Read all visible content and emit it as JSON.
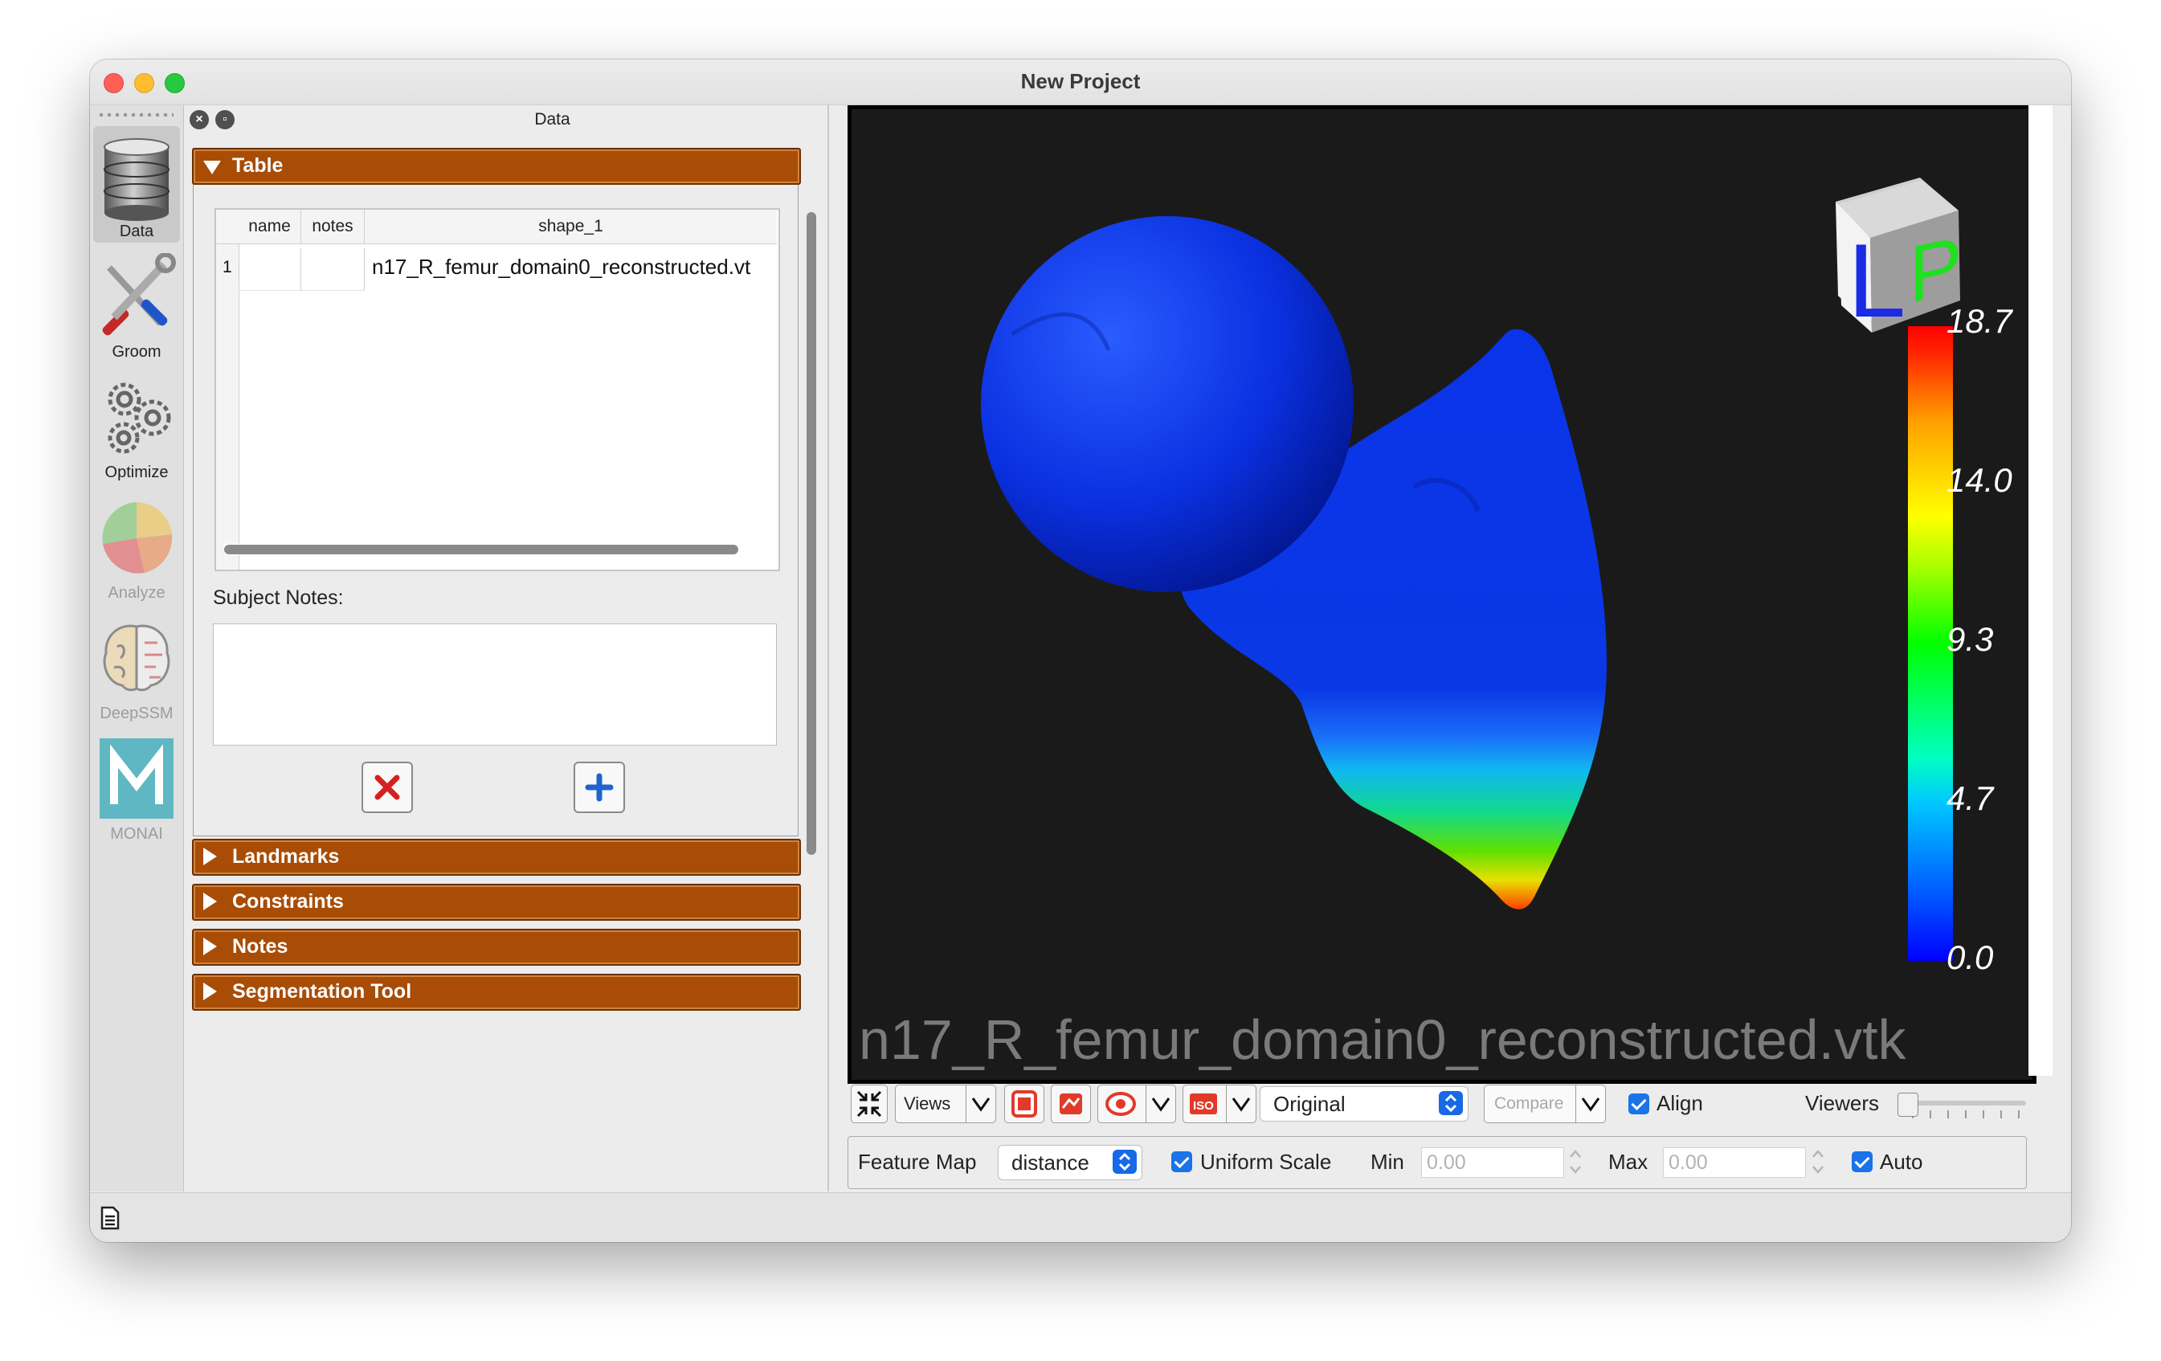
{
  "window": {
    "title": "New Project"
  },
  "modules": [
    {
      "label": "Data",
      "icon": "database-icon",
      "active": true
    },
    {
      "label": "Groom",
      "icon": "tools-icon"
    },
    {
      "label": "Optimize",
      "icon": "gears-icon"
    },
    {
      "label": "Analyze",
      "icon": "pie-chart-icon",
      "disabled": true
    },
    {
      "label": "DeepSSM",
      "icon": "brain-icon",
      "disabled": true
    },
    {
      "label": "MONAI",
      "icon": "monai-icon",
      "disabled": true
    }
  ],
  "panel": {
    "title": "Data",
    "sections": {
      "table": "Table",
      "landmarks": "Landmarks",
      "constraints": "Constraints",
      "notes": "Notes",
      "segmentation": "Segmentation Tool"
    },
    "table": {
      "columns": [
        "name",
        "notes",
        "shape_1"
      ],
      "rows": [
        {
          "index": "1",
          "name": "",
          "notes": "",
          "shape_1": "n17_R_femur_domain0_reconstructed.vt"
        }
      ]
    },
    "subject_notes_label": "Subject Notes:"
  },
  "viewer": {
    "filename": "n17_R_femur_domain0_reconstructed.vtk",
    "orientation": {
      "face_left": "L",
      "face_right": "P"
    },
    "colorbar": {
      "ticks": [
        "18.7",
        "14.0",
        "9.3",
        "4.7",
        "0.0"
      ],
      "min": 0.0,
      "max": 18.7
    }
  },
  "toolbar": {
    "views_label": "Views",
    "display_mode": "Original",
    "compare_label": "Compare",
    "align_label": "Align",
    "viewers_label": "Viewers"
  },
  "feature_map": {
    "label": "Feature Map",
    "value": "distance",
    "uniform_scale_label": "Uniform Scale",
    "min_label": "Min",
    "min_value": "0.00",
    "max_label": "Max",
    "max_value": "0.00",
    "auto_label": "Auto"
  },
  "colors": {
    "accordion": "#a84c06",
    "checkbox": "#1a73e8"
  }
}
